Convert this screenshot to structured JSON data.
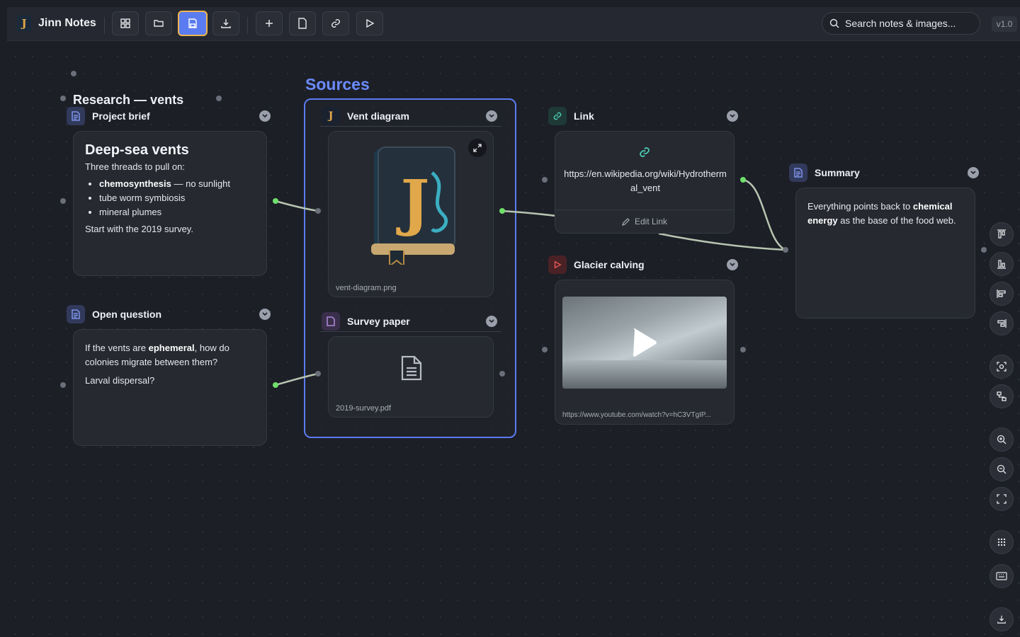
{
  "app": {
    "name": "Jinn Notes",
    "version": "v1.0",
    "logo_letter": "J"
  },
  "search": {
    "placeholder": "Search notes & images..."
  },
  "toolbar": {
    "buttons": [
      {
        "icon": "grid-icon"
      },
      {
        "icon": "folder-open-icon"
      },
      {
        "icon": "save-icon",
        "active": true
      },
      {
        "icon": "download-icon"
      },
      {
        "icon": "plus-icon"
      },
      {
        "icon": "file-icon"
      },
      {
        "icon": "link-icon"
      },
      {
        "icon": "play-icon"
      }
    ]
  },
  "canvas": {
    "board_title": "Research — vents",
    "group": {
      "title": "Sources"
    },
    "nodes": {
      "project_brief": {
        "title": "Project brief",
        "heading": "Deep-sea vents",
        "intro": "Three threads to pull on:",
        "bullets": [
          {
            "bold": "chemosynthesis",
            "rest": " — no sunlight"
          },
          {
            "bold": "",
            "rest": "tube worm symbiosis"
          },
          {
            "bold": "",
            "rest": "mineral plumes"
          }
        ],
        "outro": "Start with the 2019 survey."
      },
      "open_question": {
        "title": "Open question",
        "line1_pre": "If the vents are ",
        "line1_bold": "ephemeral",
        "line1_post": ", how do colonies migrate between them?",
        "line2": "Larval dispersal?"
      },
      "vent_diagram": {
        "title": "Vent diagram",
        "filename": "vent-diagram.png"
      },
      "survey_paper": {
        "title": "Survey paper",
        "filename": "2019-survey.pdf"
      },
      "link": {
        "title": "Link",
        "url": "https://en.wikipedia.org/wiki/Hydrothermal_vent",
        "edit_label": "Edit Link"
      },
      "glacier": {
        "title": "Glacier calving",
        "url": "https://www.youtube.com/watch?v=hC3VTgIP..."
      },
      "summary": {
        "title": "Summary",
        "pre": "Everything points back to ",
        "bold": "chemical energy",
        "post": " as the base of the food web."
      }
    }
  },
  "right_rail": [
    "align-top-icon",
    "align-bottom-icon",
    "align-left-icon",
    "align-right-icon",
    "fit-selection-icon",
    "connect-icon",
    "zoom-in-icon",
    "zoom-out-icon",
    "fullscreen-icon",
    "grid-dots-icon",
    "keyboard-icon",
    "export-icon"
  ],
  "colors": {
    "accent": "#5b7cf0",
    "highlight": "#f0b450",
    "wire": "#b8c4b0",
    "port_active": "#6fe06a"
  }
}
